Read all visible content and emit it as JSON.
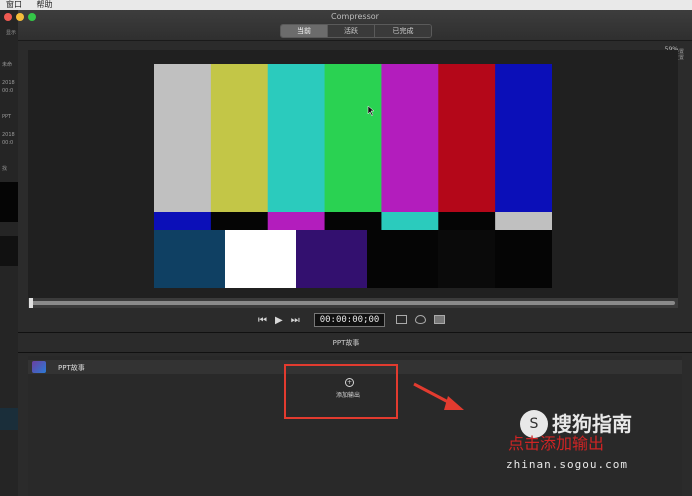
{
  "menubar": {
    "items": [
      "窗口",
      "帮助"
    ]
  },
  "app": {
    "title": "Compressor"
  },
  "tabs": [
    {
      "label": "当前",
      "active": true
    },
    {
      "label": "活跃",
      "active": false
    },
    {
      "label": "已完成",
      "active": false
    }
  ],
  "left_panel": {
    "top_label": "显示",
    "items": [
      {
        "title": "未命",
        "line1": "2018",
        "line2": "00:0"
      },
      {
        "title": "PPT",
        "line1": "2018",
        "line2": "00:0"
      },
      {
        "title": "找"
      }
    ]
  },
  "right_info": {
    "label_line1": "设置",
    "label_line2": "位置",
    "zoom": "59%"
  },
  "viewer": {
    "top_bars": [
      "#c0c0c0",
      "#c3c647",
      "#2bcbbd",
      "#2ad252",
      "#b31dbd",
      "#b40719",
      "#0b0fb8"
    ],
    "middle_bars": [
      "#0b0fb8",
      "#050505",
      "#b31dbd",
      "#050505",
      "#2bcbbd",
      "#050505",
      "#c0c0c0"
    ],
    "bottom_blocks": [
      "#0f4063",
      "#ffffff",
      "#33106f",
      "#050505",
      "#0a0a0a",
      "#050505",
      "#050505"
    ]
  },
  "transport": {
    "timecode": "00:00:00;00",
    "progress": 0.0
  },
  "section": {
    "title": "PPT故事"
  },
  "job": {
    "label": "PPT故事"
  },
  "add_output": {
    "icon": "plus-circle-icon",
    "label": "添加输出"
  },
  "annotation": {
    "color": "#e23b2f",
    "text": "点击添加输出"
  },
  "watermark": {
    "brand": "搜狗指南",
    "url": "zhinan.sogou.com"
  }
}
